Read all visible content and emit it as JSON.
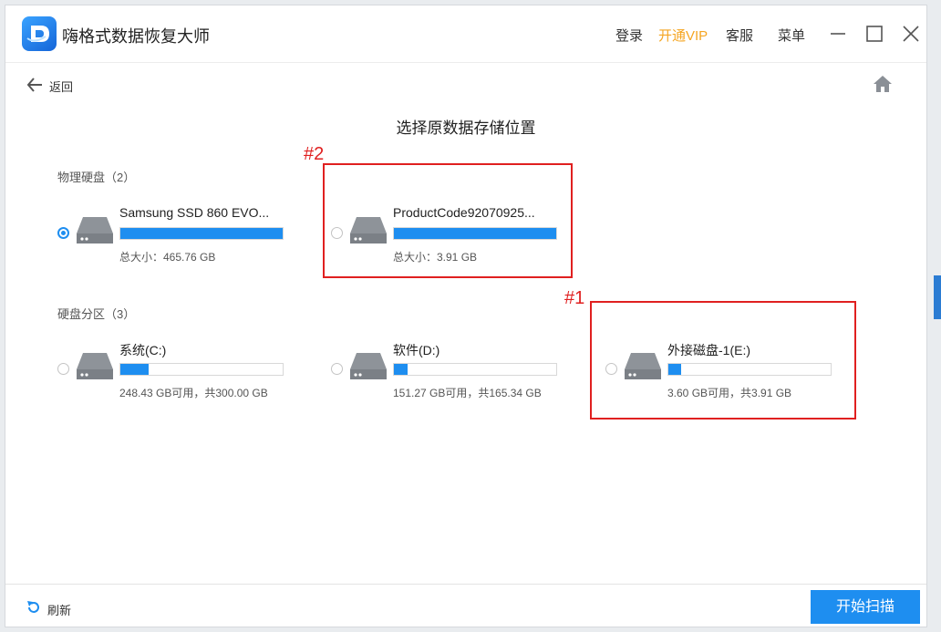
{
  "app": {
    "title": "嗨格式数据恢复大师"
  },
  "topbar": {
    "login": "登录",
    "vip": "开通VIP",
    "service": "客服",
    "menu": "菜单"
  },
  "nav": {
    "back_label": "返回"
  },
  "page": {
    "title": "选择原数据存储位置"
  },
  "physical": {
    "label": "物理硬盘（2）",
    "items": [
      {
        "name": "Samsung SSD 860 EVO...",
        "info": "总大小：465.76 GB",
        "used_fraction": 1.0,
        "selected": true
      },
      {
        "name": "ProductCode92070925...",
        "info": "总大小：3.91 GB",
        "used_fraction": 1.0,
        "selected": false
      }
    ]
  },
  "partitions": {
    "label": "硬盘分区（3）",
    "items": [
      {
        "name": "系统(C:)",
        "info": "248.43 GB可用，共300.00 GB",
        "used_fraction": 0.172,
        "selected": false
      },
      {
        "name": "软件(D:)",
        "info": "151.27 GB可用，共165.34 GB",
        "used_fraction": 0.085,
        "selected": false
      },
      {
        "name": "外接磁盘-1(E:)",
        "info": "3.60 GB可用，共3.91 GB",
        "used_fraction": 0.079,
        "selected": false
      }
    ]
  },
  "annotations": {
    "a1": "#1",
    "a2": "#2"
  },
  "footer": {
    "refresh_label": "刷新",
    "scan_button": "开始扫描"
  },
  "colors": {
    "accent": "#1e8ef0",
    "vip": "#f5a623",
    "annotation": "#e02020"
  }
}
